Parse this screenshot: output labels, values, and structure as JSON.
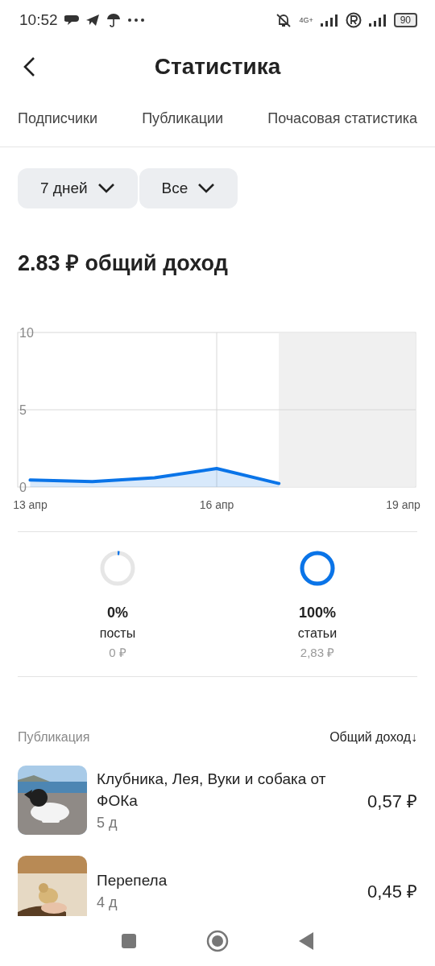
{
  "status_bar": {
    "time": "10:52",
    "network": "4G+",
    "battery": "90"
  },
  "header": {
    "title": "Статистика"
  },
  "tabs": [
    {
      "label": "Подписчики",
      "selected": false
    },
    {
      "label": "Публикации",
      "selected": false
    },
    {
      "label": "Почасовая статистика",
      "selected": false
    }
  ],
  "filters": [
    {
      "label": "7 дней"
    },
    {
      "label": "Все"
    }
  ],
  "total": "2.83 ₽ общий доход",
  "chart": {
    "chart_data": {
      "type": "area",
      "x": [
        13,
        14,
        15,
        16,
        17
      ],
      "series": [
        {
          "color": "#0a74e8",
          "values": [
            0.45,
            0.35,
            0.6,
            1.2,
            0.23
          ]
        }
      ],
      "xlim": [
        12.8,
        19.2
      ],
      "grid": true,
      "ylim": [
        0,
        10
      ],
      "yticks": [
        0,
        5,
        10
      ],
      "xticks": [
        {
          "value": 13,
          "label": "13 апр"
        },
        {
          "value": 16,
          "label": "16 апр"
        },
        {
          "value": 19,
          "label": "19 апр"
        }
      ]
    }
  },
  "shares": [
    {
      "percent": "0%",
      "label": "посты",
      "amount": "0 ₽",
      "level": 0.02
    },
    {
      "percent": "100%",
      "label": "статьи",
      "amount": "2,83 ₽",
      "level": 1
    }
  ],
  "list_header": {
    "column_1": "Публикация",
    "column_2": "Общий доход↓"
  },
  "publications": [
    {
      "title": "Клубника, Лея, Вуки и собака от ФОКа",
      "age": "5 д",
      "income": "0,57 ₽",
      "kind": "picture"
    },
    {
      "title": "Перепела",
      "age": "4 д",
      "income": "0,45 ₽",
      "kind": "picture"
    }
  ]
}
